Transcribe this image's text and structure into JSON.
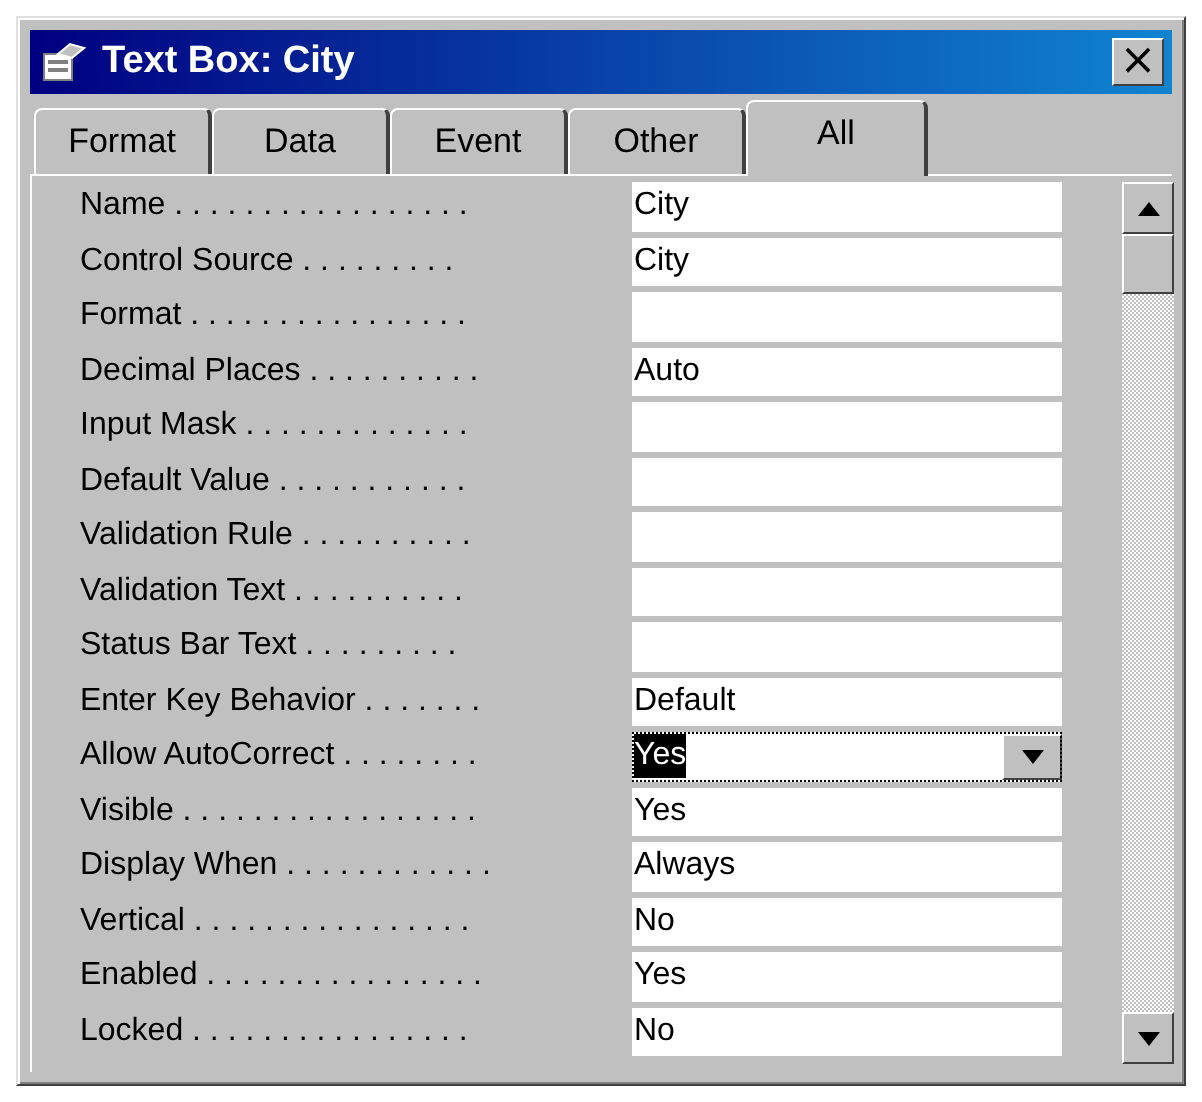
{
  "window": {
    "title": "Text Box: City",
    "close": "×"
  },
  "tabs": [
    {
      "label": "Format",
      "selected": false
    },
    {
      "label": "Data",
      "selected": false
    },
    {
      "label": "Event",
      "selected": false
    },
    {
      "label": "Other",
      "selected": false
    },
    {
      "label": "All",
      "selected": true
    }
  ],
  "properties": [
    {
      "label": "Name . . . . . . . . . . . . . . . . .",
      "value": "City",
      "kind": "text",
      "selected": false
    },
    {
      "label": "Control Source . . . . . . . . .",
      "value": "City",
      "kind": "text",
      "selected": false
    },
    {
      "label": "Format . . . . . . . . . . . . . . . .",
      "kind": "text",
      "selected": false
    },
    {
      "label": "Decimal Places . . . . . . . . . .",
      "value": "Auto",
      "kind": "text",
      "selected": false
    },
    {
      "label": "Input Mask . . . . . . . . . . . . .",
      "kind": "text",
      "selected": false
    },
    {
      "label": "Default Value . . . . . . . . . . .",
      "kind": "text",
      "selected": false
    },
    {
      "label": "Validation Rule . . . . . . . . . .",
      "kind": "text",
      "selected": false
    },
    {
      "label": "Validation Text . . . . . . . . . .",
      "kind": "text",
      "selected": false
    },
    {
      "label": "Status Bar Text . . . . . . . . .",
      "kind": "text",
      "selected": false
    },
    {
      "label": "Enter Key Behavior . . . . . . .",
      "value": "Default",
      "kind": "text",
      "selected": false
    },
    {
      "label": "Allow AutoCorrect . . . . . . . .",
      "value": "Yes",
      "kind": "dropdown",
      "selected": true
    },
    {
      "label": "Visible . . . . . . . . . . . . . . . . .",
      "value": "Yes",
      "kind": "text",
      "selected": false
    },
    {
      "label": "Display When . . . . . . . . . . . .",
      "value": "Always",
      "kind": "text",
      "selected": false
    },
    {
      "label": "Vertical . . . . . . . . . . . . . . . .",
      "value": "No",
      "kind": "text",
      "selected": false
    },
    {
      "label": "Enabled . . . . . . . . . . . . . . . .",
      "value": "Yes",
      "kind": "text",
      "selected": false
    },
    {
      "label": "Locked . . . . . . . . . . . . . . . .",
      "value": "No",
      "kind": "text",
      "selected": false
    }
  ]
}
